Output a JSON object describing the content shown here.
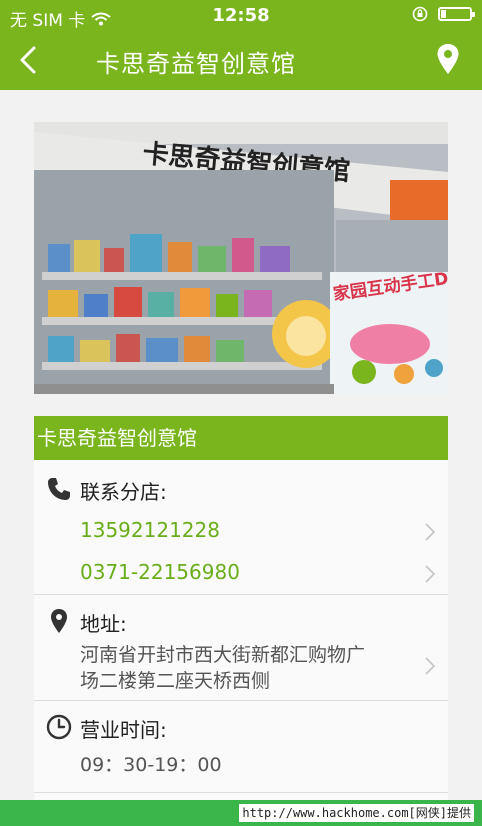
{
  "status_bar": {
    "carrier": "无 SIM 卡",
    "time": "12:58",
    "battery_level": 0.15
  },
  "nav": {
    "title": "卡思奇益智创意馆",
    "back_icon": "chevron-left-icon",
    "location_icon": "map-pin-icon"
  },
  "store": {
    "photo_sign_text": "卡思奇益智创意馆",
    "photo_banner_text": "家园互动手工DIY",
    "name": "卡思奇益智创意馆",
    "contact": {
      "label": "联系分店:",
      "phones": [
        "13592121228",
        "0371-22156980"
      ]
    },
    "address": {
      "label": "地址:",
      "line1": "河南省开封市西大街新都汇购物广",
      "line2": "场二楼第二座天桥西侧"
    },
    "hours": {
      "label": "营业时间:",
      "value": "09：30-19：00"
    }
  },
  "watermark": "http://www.hackhome.com[网侠]提供",
  "colors": {
    "brand_green": "#7ab51d",
    "link_green": "#6aad1a",
    "footer_green": "#39b54a"
  }
}
